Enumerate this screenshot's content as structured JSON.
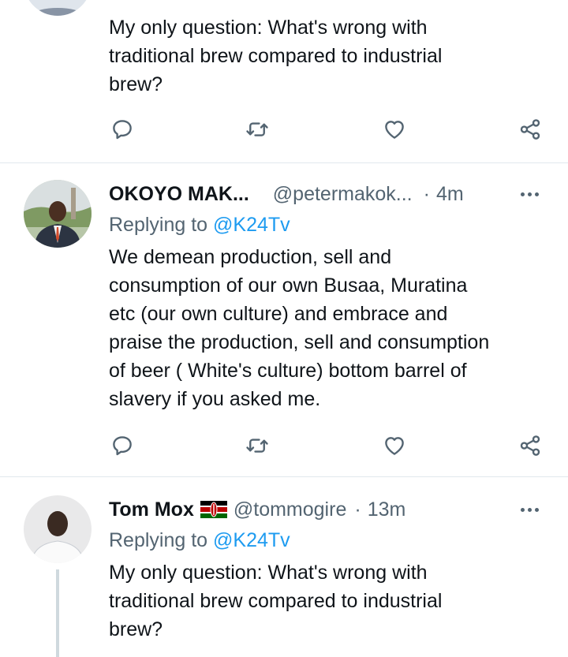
{
  "top_tweet": {
    "text_lines": [
      "My only question: What's wrong with",
      "traditional brew compared to industrial",
      "brew?"
    ]
  },
  "tweet1": {
    "name": "OKOYO MAK...",
    "handle": "@petermakok...",
    "separator": "·",
    "time": "4m",
    "replying_prefix": "Replying to ",
    "replying_to": "@K24Tv",
    "text_lines": [
      "We demean production, sell and",
      "consumption of our own Busaa, Muratina",
      "etc (our own culture) and embrace and",
      "praise the production, sell and consumption",
      "of beer ( White's culture) bottom barrel of",
      "slavery if you asked me."
    ]
  },
  "tweet2": {
    "name": "Tom Mox",
    "flag": "kenya-flag",
    "handle": "@tommogire",
    "separator": "·",
    "time": "13m",
    "replying_prefix": "Replying to ",
    "replying_to": "@K24Tv",
    "text_lines": [
      "My only question: What's wrong with",
      "traditional brew compared to industrial",
      "brew?"
    ]
  },
  "icons": [
    "reply-icon",
    "retweet-icon",
    "like-icon",
    "share-icon",
    "more-icon"
  ],
  "colors": {
    "accent": "#1d9bf0",
    "secondary_text": "#536471",
    "divider": "#e1e8ed"
  }
}
